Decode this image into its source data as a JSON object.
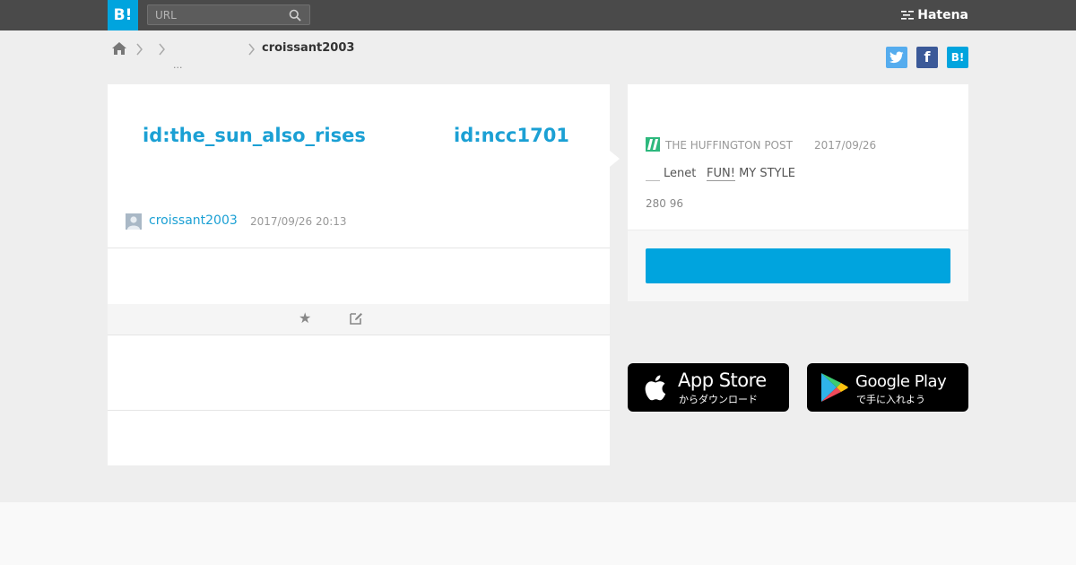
{
  "header": {
    "logo_text": "B!",
    "search_placeholder": "URL",
    "brand": "Hatena"
  },
  "breadcrumb": {
    "ellipsis": "...",
    "current": "croissant2003"
  },
  "share": {
    "twitter_icon": "twitter-icon",
    "facebook_label": "f",
    "hatena_label": "B!"
  },
  "entry": {
    "link_left": "id:the_sun_also_rises",
    "link_right": "id:ncc1701",
    "user": "croissant2003",
    "timestamp": "2017/09/26 20:13"
  },
  "actions": {
    "star_icon": "★"
  },
  "related": {
    "source": "THE HUFFINGTON POST",
    "date": "2017/09/26",
    "tag_lenet": "Lenet",
    "tag_fun": "FUN!",
    "tag_style": "MY STYLE",
    "counts": "280 96"
  },
  "badges": {
    "app_store_name": "App Store",
    "app_store_sub": "からダウンロード",
    "google_play_name": "Google Play",
    "google_play_sub": "で手に入れよう"
  },
  "colors": {
    "accent": "#00a4de",
    "link": "#1ba0d4",
    "topbar": "#4a4a4a",
    "source_green": "#2db87d"
  }
}
